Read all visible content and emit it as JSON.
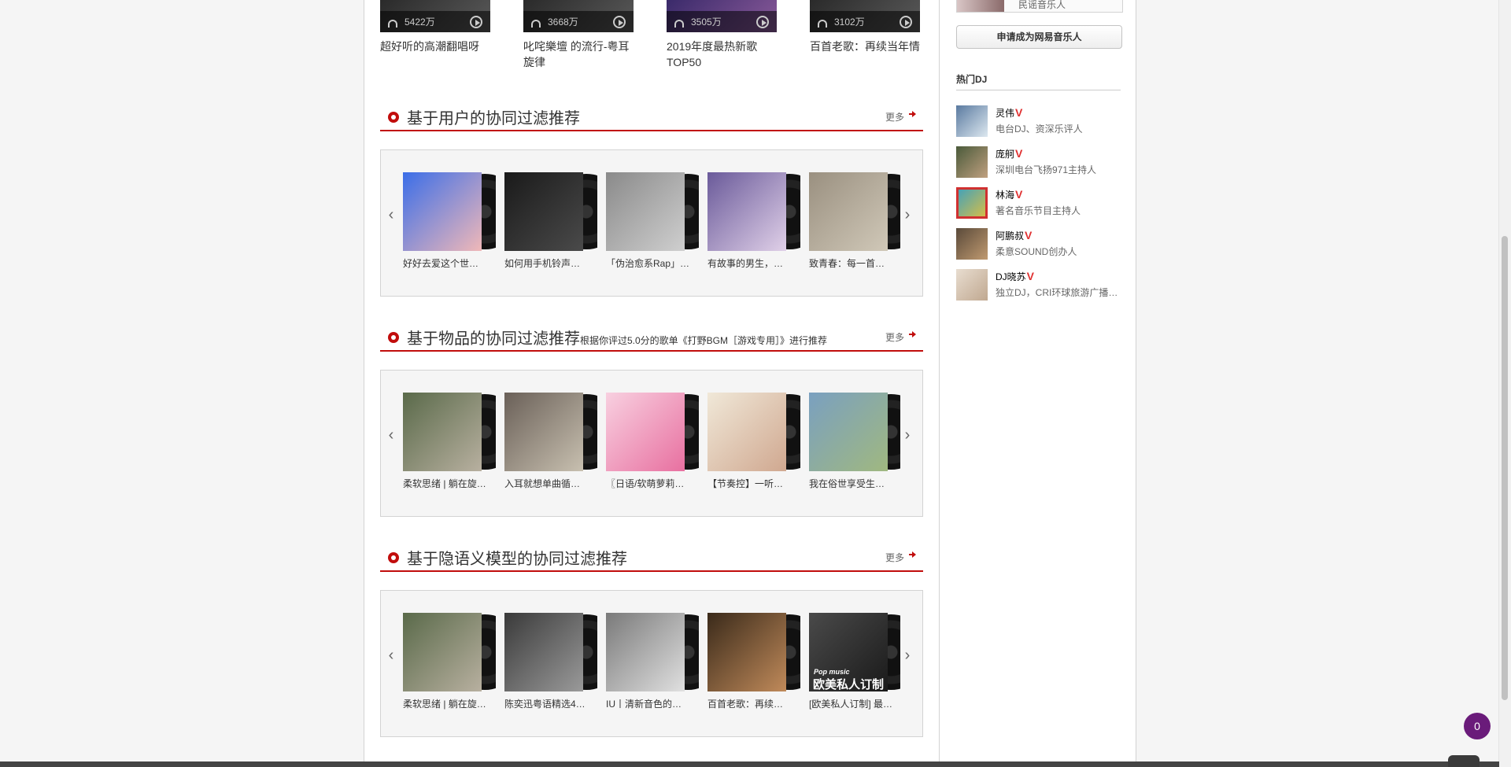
{
  "top_playlists": [
    {
      "title": "超好听的高潮翻唱呀",
      "count": "5422万"
    },
    {
      "title": "叱咤樂壇 的流行-粤耳旋律",
      "count": "3668万"
    },
    {
      "title": "2019年度最热新歌TOP50",
      "count": "3505万"
    },
    {
      "title": "百首老歌：再续当年情",
      "count": "3102万"
    }
  ],
  "sections": [
    {
      "title": "基于用户的协同过滤推荐",
      "subtitle": "",
      "more": "更多",
      "items": [
        {
          "title": "好好去爱这个世…"
        },
        {
          "title": "如何用手机铃声…"
        },
        {
          "title": "「伪治愈系Rap」…"
        },
        {
          "title": "有故事的男生，…"
        },
        {
          "title": "致青春：每一首…"
        }
      ]
    },
    {
      "title": "基于物品的协同过滤推荐",
      "subtitle": "根据你评过5.0分的歌单《打野BGM［游戏专用］》进行推荐",
      "more": "更多",
      "items": [
        {
          "title": "柔软思绪 | 躺在旋…"
        },
        {
          "title": "入耳就想单曲循…"
        },
        {
          "title": "〖日语/软萌萝莉…"
        },
        {
          "title": "【节奏控】一听…"
        },
        {
          "title": "我在俗世享受生…"
        }
      ]
    },
    {
      "title": "基于隐语义模型的协同过滤推荐",
      "subtitle": "",
      "more": "更多",
      "items": [
        {
          "title": "柔软思绪 | 躺在旋…"
        },
        {
          "title": "陈奕迅粤语精选4…"
        },
        {
          "title": "IU丨清新音色的…"
        },
        {
          "title": "百首老歌：再续…"
        },
        {
          "title": "[欧美私人订制] 最…",
          "cover_caption_small": "Pop music",
          "cover_caption": "欧美私人订制"
        }
      ]
    }
  ],
  "sidebar": {
    "top_artist_desc": "民谣音乐人",
    "apply_button": "申请成为网易音乐人",
    "dj_heading": "热门DJ",
    "djs": [
      {
        "name": "灵伟",
        "v": "V",
        "desc": "电台DJ、资深乐评人"
      },
      {
        "name": "庞舸",
        "v": "V",
        "desc": "深圳电台飞扬971主持人"
      },
      {
        "name": "林海",
        "v": "V",
        "desc": "著名音乐节目主持人"
      },
      {
        "name": "阿鹏叔",
        "v": "V",
        "desc": "柔意SOUND创办人"
      },
      {
        "name": "DJ晓苏",
        "v": "V",
        "desc": "独立DJ，CRI环球旅游广播…"
      }
    ]
  },
  "badge_count": "0",
  "colors": {
    "accent": "#c10d0c",
    "dj_v": "#e03131",
    "badge": "#6a1b7a"
  }
}
